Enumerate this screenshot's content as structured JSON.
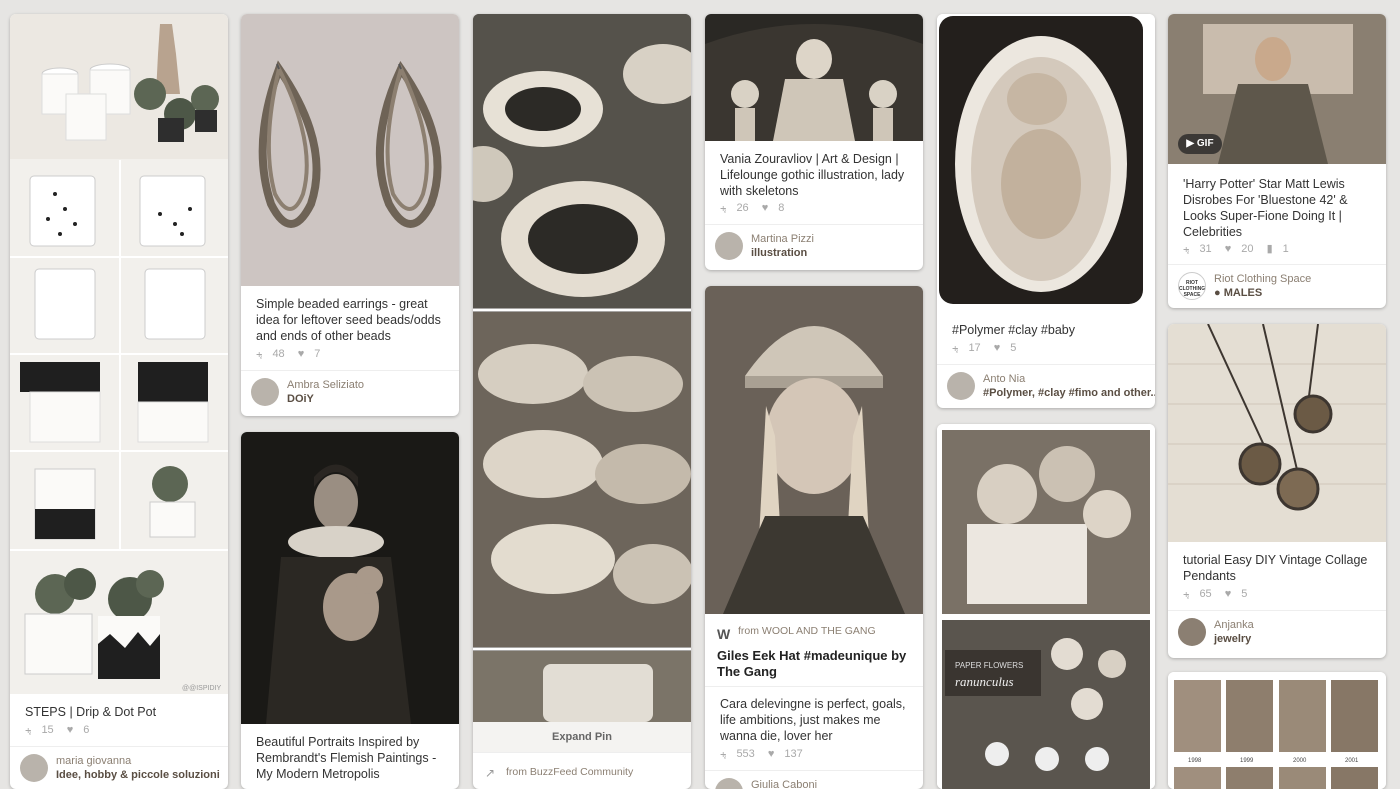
{
  "colors": {
    "background": "#e6e5e3",
    "card": "#ffffff",
    "text": "#333333",
    "muted": "#a9a9a9",
    "attribution": "#8b7f72"
  },
  "icons": {
    "repin": "pushpin-icon",
    "like": "heart-icon",
    "comment": "comment-icon",
    "gif": "play-icon",
    "location": "location-pin-icon"
  },
  "pins": {
    "drip_pot": {
      "description": "STEPS | Drip & Dot Pot",
      "repins": "15",
      "likes": "6",
      "watermark": "@@ISPIDIY",
      "user": "maria giovanna",
      "board": "Idee, hobby & piccole soluzioni"
    },
    "earrings": {
      "description": "Simple beaded earrings - great idea for leftover seed beads/odds and ends of other beads",
      "repins": "48",
      "likes": "7",
      "user": "Ambra Seliziato",
      "board": "DOiY"
    },
    "portrait": {
      "description": "Beautiful Portraits Inspired by Rembrandt's Flemish Paintings - My Modern Metropolis"
    },
    "buzzfeed": {
      "expand": "Expand Pin",
      "source": "from BuzzFeed Community"
    },
    "skeletons": {
      "description": "Vania Zouravliov | Art & Design | Lifelounge gothic illustration, lady with skeletons",
      "repins": "26",
      "likes": "8",
      "user": "Martina Pizzi",
      "board": "illustration"
    },
    "hat": {
      "source": "from WOOL AND THE GANG",
      "title": "Giles Eek Hat #madeunique by The Gang",
      "description": "Cara delevingne is perfect, goals, life ambitions, just makes me wanna die, lover her",
      "repins": "553",
      "likes": "137",
      "user": "Giulia Caboni"
    },
    "baby": {
      "description": "#Polymer #clay #baby",
      "repins": "17",
      "likes": "5",
      "user": "Anto Nia",
      "board": "#Polymer, #clay #fimo and other..."
    },
    "roses": {
      "sign1": "PAPER FLOWERS",
      "sign2": "ranunculus"
    },
    "potter": {
      "gif": "GIF",
      "description": "'Harry Potter' Star Matt Lewis Disrobes For 'Bluestone 42' & Looks Super-Fione Doing It | Celebrities",
      "repins": "31",
      "likes": "20",
      "comments": "1",
      "user": "Riot Clothing Space",
      "board": "MALES",
      "avatar_text": "RIOT CLOTHING SPACE"
    },
    "pendants": {
      "description": "tutorial Easy DIY Vintage Collage Pendants",
      "repins": "65",
      "likes": "5",
      "user": "Anjanka",
      "board": "jewelry"
    },
    "photos": {
      "years": [
        "1998",
        "1999",
        "2000",
        "2001"
      ]
    }
  }
}
